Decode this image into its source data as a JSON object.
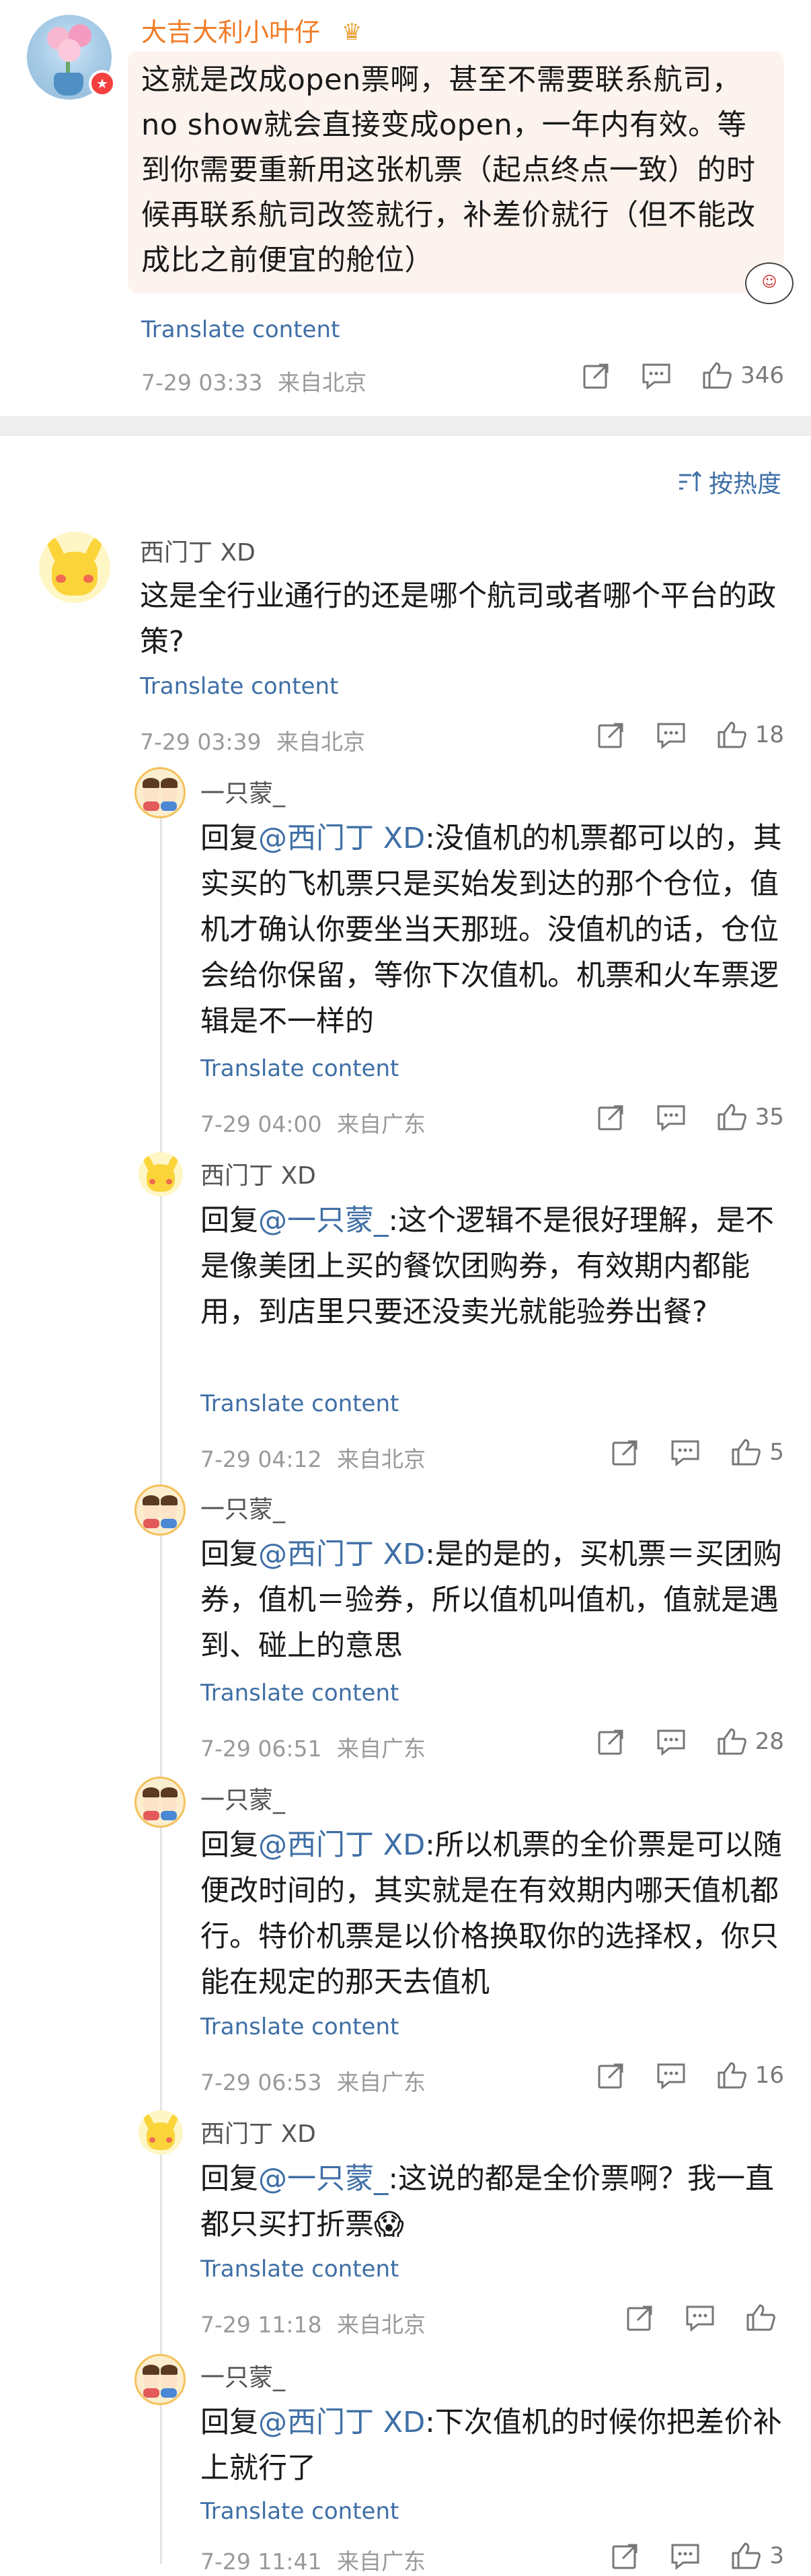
{
  "top_comment": {
    "username": "大吉大利小叶仔",
    "text": "这就是改成open票啊，甚至不需要联系航司，no show就会直接变成open，一年内有效。等到你需要重新用这张机票（起点终点一致）的时候再联系航司改签就行，补差价就行（但不能改成比之前便宜的舱位）",
    "translate": "Translate content",
    "time": "7-29 03:33",
    "location": "来自北京",
    "likes": "346",
    "sticker": "☺"
  },
  "sort_label": "按热度",
  "main_comment": {
    "username": "西门丁 XD",
    "text": "这是全行业通行的还是哪个航司或者哪个平台的政策?",
    "translate": "Translate content",
    "time": "7-29 03:39",
    "location": "来自北京",
    "likes": "18"
  },
  "replies": [
    {
      "username": "一只蒙_",
      "prefix": "回复",
      "mention": "@西门丁 XD",
      "text": ":没值机的机票都可以的，其实买的飞机票只是买始发到达的那个仓位，值机才确认你要坐当天那班。没值机的话，仓位会给你保留，等你下次值机。机票和火车票逻辑是不一样的",
      "translate": "Translate content",
      "time": "7-29 04:00",
      "location": "来自广东",
      "likes": "35"
    },
    {
      "username": "西门丁 XD",
      "prefix": "回复",
      "mention": "@一只蒙_",
      "text": ":这个逻辑不是很好理解，是不是像美团上买的餐饮团购券，有效期内都能用，到店里只要还没卖光就能验券出餐?",
      "translate": "Translate content",
      "time": "7-29 04:12",
      "location": "来自北京",
      "likes": "5"
    },
    {
      "username": "一只蒙_",
      "prefix": "回复",
      "mention": "@西门丁 XD",
      "text": ":是的是的，买机票＝买团购券，值机＝验券，所以值机叫值机，值就是遇到、碰上的意思",
      "translate": "Translate content",
      "time": "7-29 06:51",
      "location": "来自广东",
      "likes": "28"
    },
    {
      "username": "一只蒙_",
      "prefix": "回复",
      "mention": "@西门丁 XD",
      "text": ":所以机票的全价票是可以随便改时间的，其实就是在有效期内哪天值机都行。特价机票是以价格换取你的选择权，你只能在规定的那天去值机",
      "translate": "Translate content",
      "time": "7-29 06:53",
      "location": "来自广东",
      "likes": "16"
    },
    {
      "username": "西门丁 XD",
      "prefix": "回复",
      "mention": "@一只蒙_",
      "text": ":这说的都是全价票啊？我一直都只买打折票",
      "emoji": "😱",
      "translate": "Translate content",
      "time": "7-29 11:18",
      "location": "来自北京",
      "likes": ""
    },
    {
      "username": "一只蒙_",
      "prefix": "回复",
      "mention": "@西门丁 XD",
      "text": ":下次值机的时候你把差价补上就行了",
      "translate": "Translate content",
      "time": "7-29 11:41",
      "location": "来自广东",
      "likes": "3"
    }
  ],
  "colors": {
    "link": "#3f6fa6",
    "vip_name": "#f07b25",
    "meta": "#9a9a9a",
    "divider": "#eeeeee"
  },
  "icons": [
    "share-icon",
    "comment-icon",
    "like-icon",
    "sort-icon",
    "vip-badge-icon",
    "crown-icon"
  ]
}
